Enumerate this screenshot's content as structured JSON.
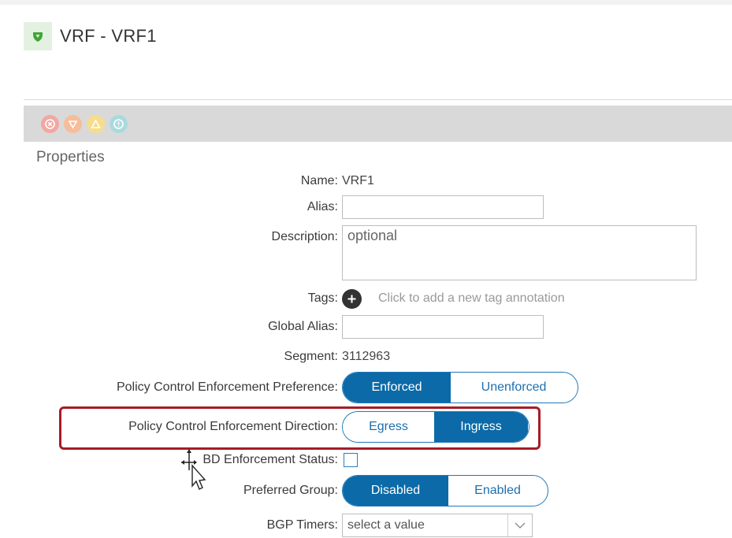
{
  "header": {
    "title": "VRF - VRF1",
    "icon": "shield-icon",
    "icon_color": "#3fa535"
  },
  "fault_bar": {
    "icons": [
      {
        "name": "critical-fault-icon",
        "color": "#f2a7a2"
      },
      {
        "name": "major-fault-icon",
        "color": "#f6bd9b"
      },
      {
        "name": "minor-fault-icon",
        "color": "#f7dc8c"
      },
      {
        "name": "warning-fault-icon",
        "color": "#a9dadd"
      }
    ]
  },
  "section": {
    "title": "Properties"
  },
  "fields": {
    "name": {
      "label": "Name:",
      "value": "VRF1"
    },
    "alias": {
      "label": "Alias:",
      "value": ""
    },
    "description": {
      "label": "Description:",
      "placeholder": "optional"
    },
    "tags": {
      "label": "Tags:",
      "hint": "Click to add a new tag annotation"
    },
    "global_alias": {
      "label": "Global Alias:",
      "value": ""
    },
    "segment": {
      "label": "Segment:",
      "value": "3112963"
    },
    "enforcement_preference": {
      "label": "Policy Control Enforcement Preference:",
      "options": [
        "Enforced",
        "Unenforced"
      ],
      "selected": "Enforced"
    },
    "enforcement_direction": {
      "label": "Policy Control Enforcement Direction:",
      "options": [
        "Egress",
        "Ingress"
      ],
      "selected": "Ingress"
    },
    "bd_enforcement": {
      "label": "BD Enforcement Status:",
      "checked": false
    },
    "preferred_group": {
      "label": "Preferred Group:",
      "options": [
        "Disabled",
        "Enabled"
      ],
      "selected": "Disabled"
    },
    "bgp_timers": {
      "label": "BGP Timers:",
      "placeholder": "select a value"
    }
  },
  "colors": {
    "accent": "#0b6aa7",
    "highlight_border": "#a51c26"
  }
}
